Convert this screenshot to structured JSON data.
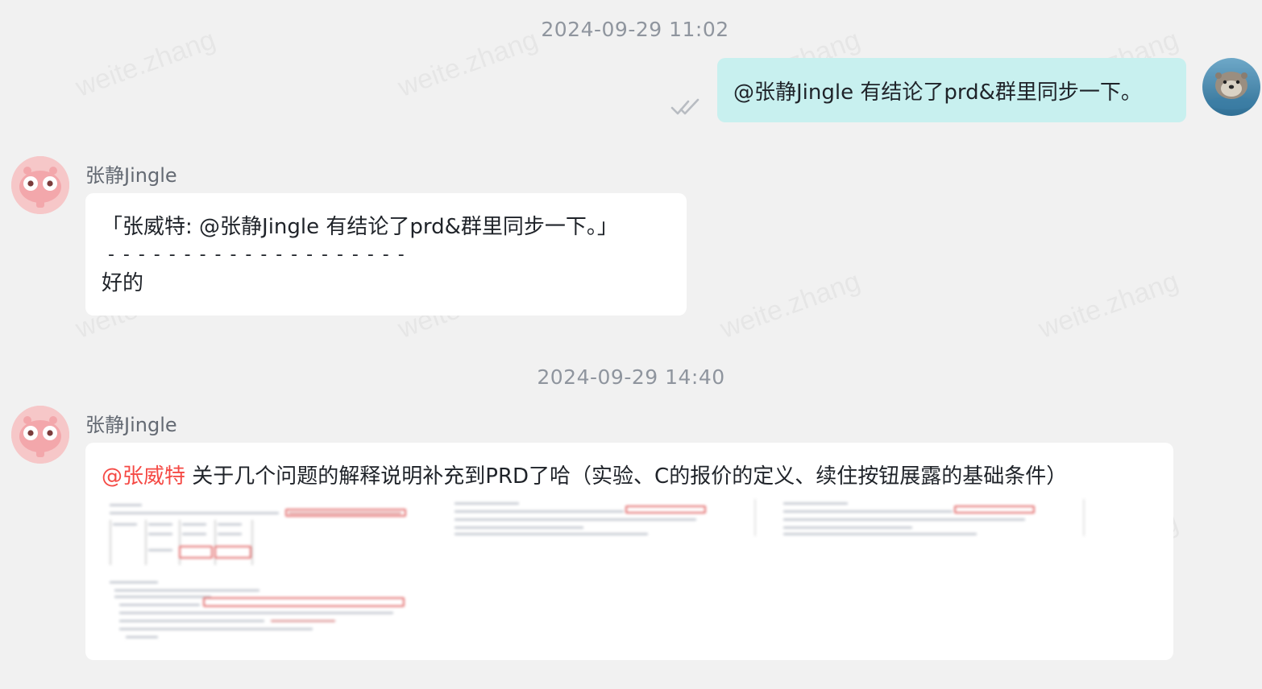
{
  "watermark": "weite.zhang",
  "messages": {
    "ts1": "2024-09-29 11:02",
    "outgoing_text": "@张静Jingle 有结论了prd&群里同步一下。",
    "msg1": {
      "sender": "张静Jingle",
      "quote": "「张威特: @张静Jingle 有结论了prd&群里同步一下。」",
      "divider": "- - - - - - - - - - - - - - - - - - - -",
      "reply": "好的"
    },
    "ts2": "2024-09-29 14:40",
    "msg2": {
      "sender": "张静Jingle",
      "mention": "@张威特",
      "text": " 关于几个问题的解释说明补充到PRD了哈（实验、C的报价的定义、续住按钮展露的基础条件）"
    }
  },
  "colors": {
    "background": "#f1f1f1",
    "outgoing_bubble": "#c8f0ef",
    "incoming_bubble": "#ffffff",
    "mention": "#f54a45",
    "meta_text": "#8f959e"
  },
  "icons": {
    "read_receipt": "double-check-icon"
  }
}
